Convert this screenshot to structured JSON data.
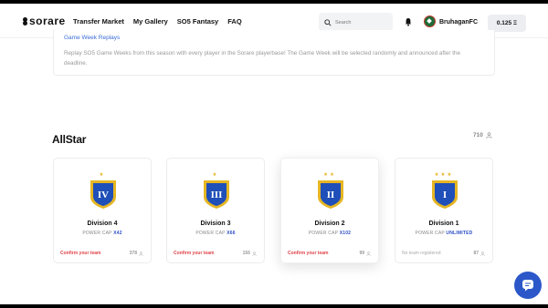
{
  "header": {
    "logo": "sorare",
    "nav": [
      "Transfer Market",
      "My Gallery",
      "SO5 Fantasy",
      "FAQ"
    ],
    "search_placeholder": "Search",
    "club_name": "BruhaganFC",
    "balance": "0.125 Ξ"
  },
  "replay": {
    "title": "Game Week Replays",
    "description": "Replay SO5 Game Weeks from this season with every player in the Sorare playerbase! The Game Week will be selected randomly and announced after the deadline."
  },
  "allstar": {
    "title": "AllStar",
    "count": "710",
    "divisions": [
      {
        "name": "Division 4",
        "cap_label": "POWER CAP",
        "cap_value": "X42",
        "numeral": "IV",
        "stars": "★",
        "footer": "Confirm your team",
        "footer_state": "action",
        "users": "378"
      },
      {
        "name": "Division 3",
        "cap_label": "POWER CAP",
        "cap_value": "X66",
        "numeral": "III",
        "stars": "★",
        "footer": "Confirm your team",
        "footer_state": "action",
        "users": "156"
      },
      {
        "name": "Division 2",
        "cap_label": "POWER CAP",
        "cap_value": "X102",
        "numeral": "II",
        "stars": "★★",
        "footer": "Confirm your team",
        "footer_state": "action",
        "users": "99"
      },
      {
        "name": "Division 1",
        "cap_label": "POWER CAP",
        "cap_value": "UNLIMITED",
        "numeral": "I",
        "stars": "★★★",
        "footer": "No team registered",
        "footer_state": "muted",
        "users": "87"
      }
    ]
  },
  "colors": {
    "accent_blue": "#2b57c9",
    "shield_gold": "#e6b624",
    "shield_blue": "#1f4fb8",
    "alert_red": "#e0444a"
  }
}
